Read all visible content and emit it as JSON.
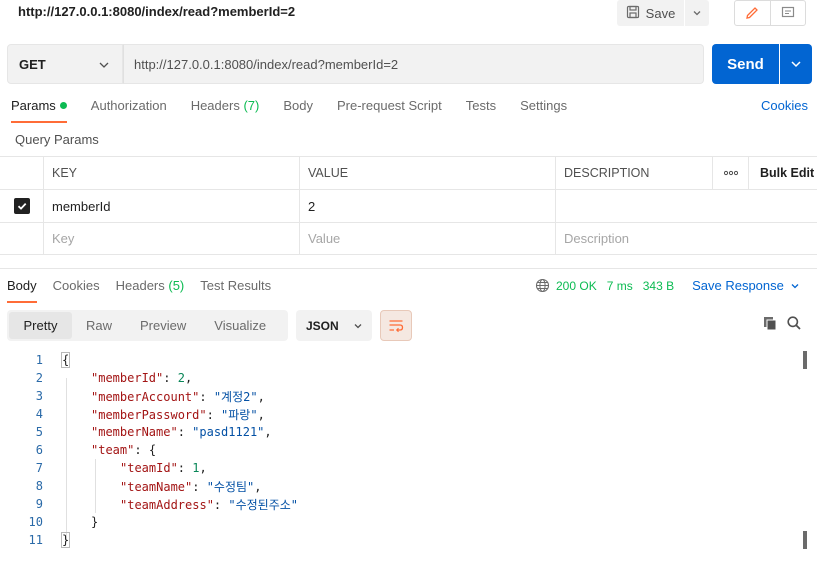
{
  "top": {
    "url_title": "http://127.0.0.1:8080/index/read?memberId=2",
    "save_label": "Save"
  },
  "request": {
    "method": "GET",
    "url": "http://127.0.0.1:8080/index/read?memberId=2",
    "send_label": "Send"
  },
  "req_tabs": {
    "params": "Params",
    "authorization": "Authorization",
    "headers": "Headers",
    "headers_count": "(7)",
    "body": "Body",
    "prerequest": "Pre-request Script",
    "tests": "Tests",
    "settings": "Settings",
    "cookies": "Cookies"
  },
  "query_params": {
    "title": "Query Params",
    "headers": {
      "key": "KEY",
      "value": "VALUE",
      "description": "DESCRIPTION",
      "more": "ooo",
      "bulk_edit": "Bulk Edit"
    },
    "rows": [
      {
        "key": "memberId",
        "value": "2",
        "description": ""
      }
    ],
    "placeholders": {
      "key": "Key",
      "value": "Value",
      "description": "Description"
    }
  },
  "response": {
    "tabs": {
      "body": "Body",
      "cookies": "Cookies",
      "headers": "Headers",
      "headers_count": "(5)",
      "test_results": "Test Results"
    },
    "status": "200 OK",
    "time": "7 ms",
    "size": "343 B",
    "save_response": "Save Response",
    "views": [
      "Pretty",
      "Raw",
      "Preview",
      "Visualize"
    ],
    "format": "JSON",
    "lines": [
      {
        "no": "1"
      },
      {
        "no": "2",
        "key": "\"memberId\"",
        "val": "2",
        "vtype": "n",
        "comma": true
      },
      {
        "no": "3",
        "key": "\"memberAccount\"",
        "val": "\"계정2\"",
        "vtype": "s",
        "comma": true
      },
      {
        "no": "4",
        "key": "\"memberPassword\"",
        "val": "\"파랑\"",
        "vtype": "s",
        "comma": true
      },
      {
        "no": "5",
        "key": "\"memberName\"",
        "val": "\"pasd1121\"",
        "vtype": "s",
        "comma": true
      },
      {
        "no": "6",
        "key": "\"team\"",
        "val": "{",
        "vtype": "p",
        "comma": false
      },
      {
        "no": "7",
        "key": "\"teamId\"",
        "val": "1",
        "vtype": "n",
        "comma": true
      },
      {
        "no": "8",
        "key": "\"teamName\"",
        "val": "\"수정팀\"",
        "vtype": "s",
        "comma": true
      },
      {
        "no": "9",
        "key": "\"teamAddress\"",
        "val": "\"수정된주소\"",
        "vtype": "s",
        "comma": false
      },
      {
        "no": "10"
      },
      {
        "no": "11"
      }
    ]
  }
}
